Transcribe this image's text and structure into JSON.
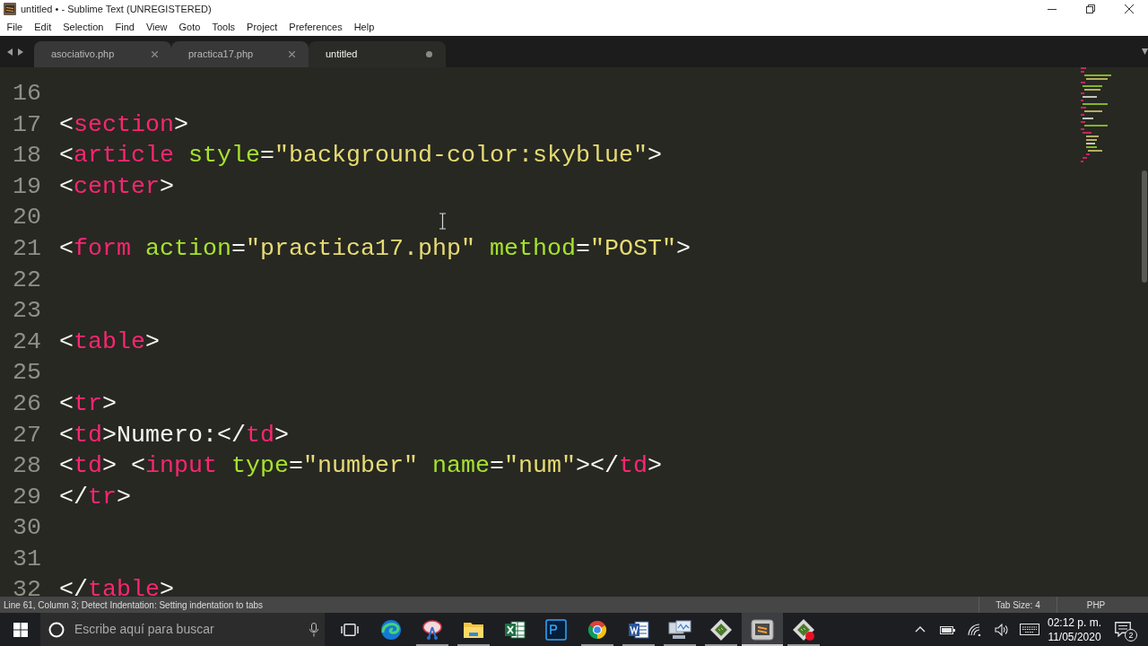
{
  "window": {
    "title": "untitled • - Sublime Text (UNREGISTERED)"
  },
  "menu": [
    "File",
    "Edit",
    "Selection",
    "Find",
    "View",
    "Goto",
    "Tools",
    "Project",
    "Preferences",
    "Help"
  ],
  "tabs": [
    {
      "label": "asociativo.php",
      "selected": false,
      "modified": false
    },
    {
      "label": "practica17.php",
      "selected": false,
      "modified": false
    },
    {
      "label": "untitled",
      "selected": true,
      "modified": true
    }
  ],
  "editor": {
    "lines": [
      {
        "number": "16"
      },
      {
        "number": "17",
        "tokens": [
          {
            "kind": "punct",
            "text": "<"
          },
          {
            "kind": "tag",
            "text": "section"
          },
          {
            "kind": "punct",
            "text": ">"
          }
        ]
      },
      {
        "number": "18",
        "tokens": [
          {
            "kind": "punct",
            "text": "<"
          },
          {
            "kind": "tag",
            "text": "article"
          },
          {
            "kind": "attr",
            "text": " style"
          },
          {
            "kind": "punct",
            "text": "="
          },
          {
            "kind": "string",
            "text": "\"background-color:skyblue\""
          },
          {
            "kind": "punct",
            "text": ">"
          }
        ]
      },
      {
        "number": "19",
        "tokens": [
          {
            "kind": "punct",
            "text": "<"
          },
          {
            "kind": "tag",
            "text": "center"
          },
          {
            "kind": "punct",
            "text": ">"
          }
        ]
      },
      {
        "number": "20"
      },
      {
        "number": "21",
        "tokens": [
          {
            "kind": "punct",
            "text": "<"
          },
          {
            "kind": "tag",
            "text": "form"
          },
          {
            "kind": "attr",
            "text": " action"
          },
          {
            "kind": "punct",
            "text": "="
          },
          {
            "kind": "string",
            "text": "\"practica17.php\""
          },
          {
            "kind": "attr",
            "text": " method"
          },
          {
            "kind": "punct",
            "text": "="
          },
          {
            "kind": "string",
            "text": "\"POST\""
          },
          {
            "kind": "punct",
            "text": ">"
          }
        ]
      },
      {
        "number": "22"
      },
      {
        "number": "23"
      },
      {
        "number": "24",
        "tokens": [
          {
            "kind": "punct",
            "text": "<"
          },
          {
            "kind": "tag",
            "text": "table"
          },
          {
            "kind": "punct",
            "text": ">"
          }
        ]
      },
      {
        "number": "25"
      },
      {
        "number": "26",
        "tokens": [
          {
            "kind": "punct",
            "text": "<"
          },
          {
            "kind": "tag",
            "text": "tr"
          },
          {
            "kind": "punct",
            "text": ">"
          }
        ]
      },
      {
        "number": "27",
        "tokens": [
          {
            "kind": "punct",
            "text": "<"
          },
          {
            "kind": "tag",
            "text": "td"
          },
          {
            "kind": "punct",
            "text": ">"
          },
          {
            "kind": "text",
            "text": "Numero:"
          },
          {
            "kind": "punct",
            "text": "</"
          },
          {
            "kind": "tag",
            "text": "td"
          },
          {
            "kind": "punct",
            "text": ">"
          }
        ]
      },
      {
        "number": "28",
        "tokens": [
          {
            "kind": "punct",
            "text": "<"
          },
          {
            "kind": "tag",
            "text": "td"
          },
          {
            "kind": "punct",
            "text": "> <"
          },
          {
            "kind": "tag",
            "text": "input"
          },
          {
            "kind": "attr",
            "text": " type"
          },
          {
            "kind": "punct",
            "text": "="
          },
          {
            "kind": "string",
            "text": "\"number\""
          },
          {
            "kind": "attr",
            "text": " name"
          },
          {
            "kind": "punct",
            "text": "="
          },
          {
            "kind": "string",
            "text": "\"num\""
          },
          {
            "kind": "punct",
            "text": "></"
          },
          {
            "kind": "tag",
            "text": "td"
          },
          {
            "kind": "punct",
            "text": ">"
          }
        ]
      },
      {
        "number": "29",
        "tokens": [
          {
            "kind": "punct",
            "text": "</"
          },
          {
            "kind": "tag",
            "text": "tr"
          },
          {
            "kind": "punct",
            "text": ">"
          }
        ]
      },
      {
        "number": "30"
      },
      {
        "number": "31"
      },
      {
        "number": "32",
        "tokens": [
          {
            "kind": "punct",
            "text": "</"
          },
          {
            "kind": "tag",
            "text": "table"
          },
          {
            "kind": "punct",
            "text": ">"
          }
        ]
      }
    ]
  },
  "status_bar": {
    "message": "Line 61, Column 3; Detect Indentation: Setting indentation to tabs",
    "tab_size": "Tab Size: 4",
    "syntax": "PHP"
  },
  "taskbar": {
    "search": {
      "placeholder": "Escribe aquí para buscar"
    },
    "apps": [
      {
        "kind": "browser-wave",
        "running": false,
        "active": false
      },
      {
        "kind": "scissors",
        "running": true,
        "active": false
      },
      {
        "kind": "folder",
        "running": true,
        "active": false
      },
      {
        "kind": "spreadsheet",
        "running": false,
        "active": false
      },
      {
        "kind": "image-editor",
        "running": false,
        "active": false
      },
      {
        "kind": "chrome",
        "running": true,
        "active": false
      },
      {
        "kind": "document",
        "running": true,
        "active": false
      },
      {
        "kind": "monitor",
        "running": true,
        "active": false
      },
      {
        "kind": "green-tile",
        "running": true,
        "active": false
      },
      {
        "kind": "code-editor",
        "running": true,
        "active": true
      },
      {
        "kind": "green-tile-alert",
        "running": true,
        "active": false
      }
    ],
    "clock": {
      "time": "02:12 p. m.",
      "date": "11/05/2020"
    },
    "notifications": "2"
  }
}
